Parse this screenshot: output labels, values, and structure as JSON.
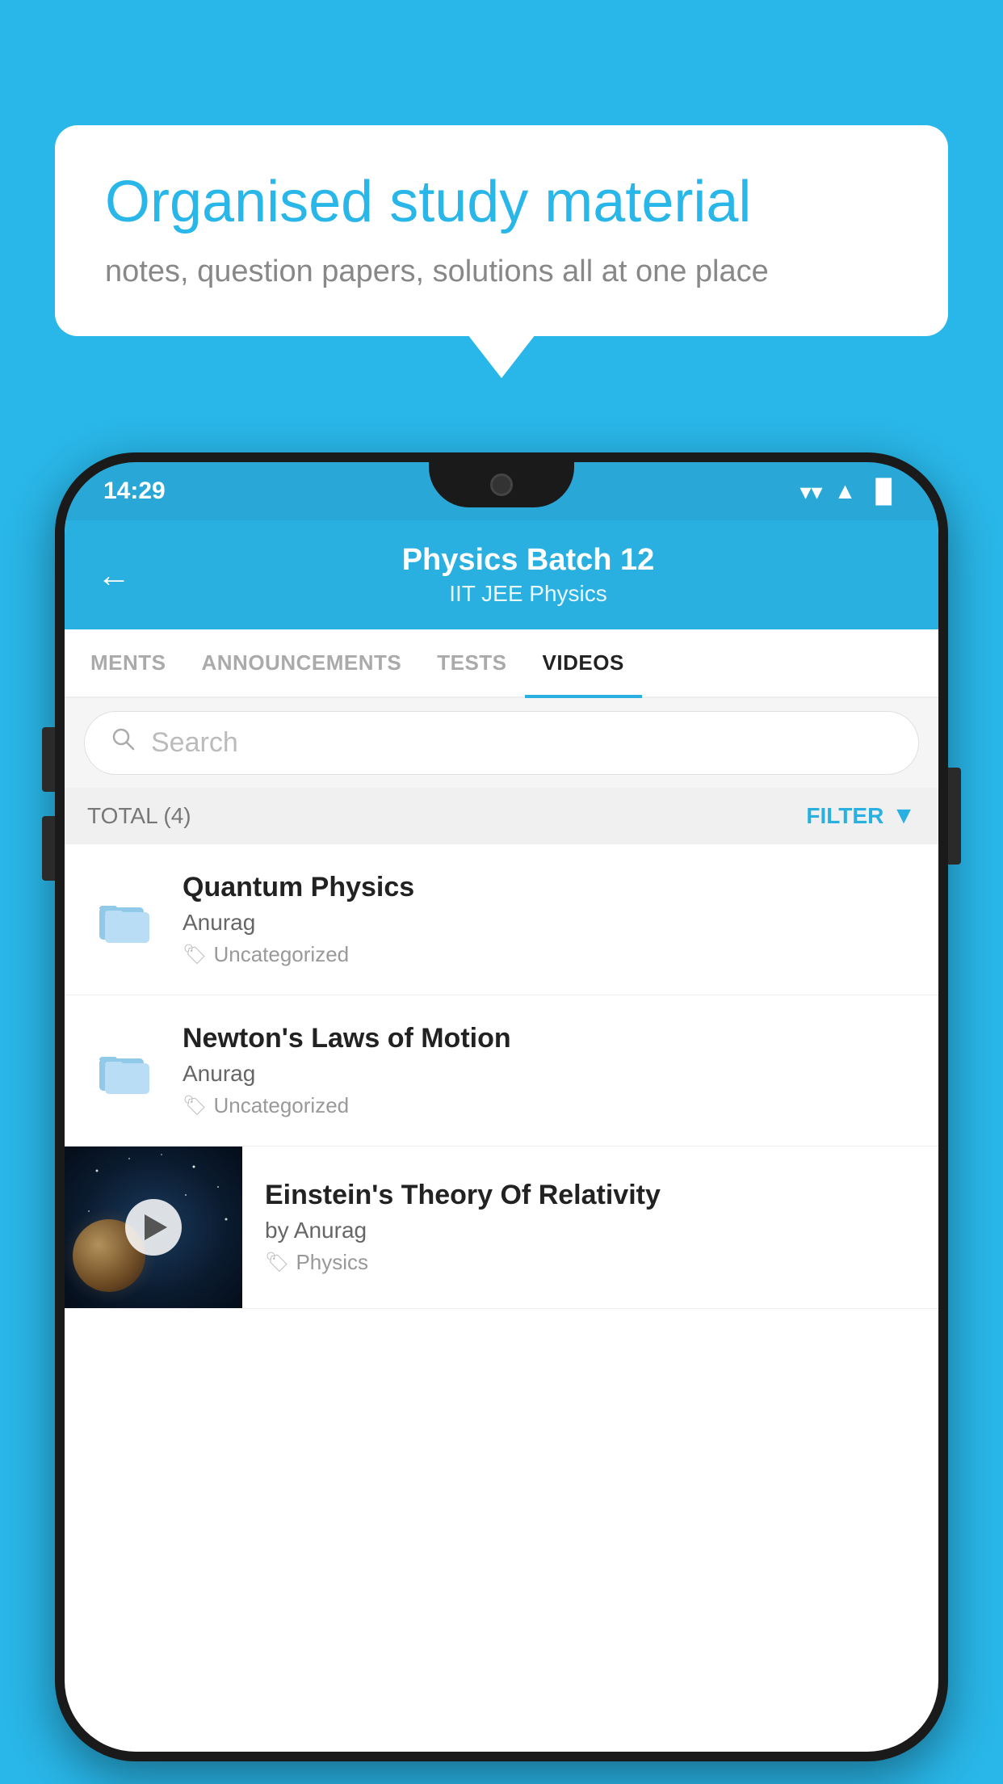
{
  "background_color": "#29b6e8",
  "bubble": {
    "title": "Organised study material",
    "subtitle": "notes, question papers, solutions all at one place"
  },
  "phone": {
    "status_bar": {
      "time": "14:29",
      "wifi": "▾",
      "signal": "▲",
      "battery": "▐"
    },
    "header": {
      "back_label": "←",
      "title": "Physics Batch 12",
      "subtitle": "IIT JEE   Physics"
    },
    "tabs": [
      {
        "label": "MENTS",
        "active": false
      },
      {
        "label": "ANNOUNCEMENTS",
        "active": false
      },
      {
        "label": "TESTS",
        "active": false
      },
      {
        "label": "VIDEOS",
        "active": true
      }
    ],
    "search": {
      "placeholder": "Search"
    },
    "filter_bar": {
      "total_label": "TOTAL (4)",
      "filter_label": "FILTER"
    },
    "videos": [
      {
        "id": 1,
        "title": "Quantum Physics",
        "author": "Anurag",
        "tag": "Uncategorized",
        "type": "folder"
      },
      {
        "id": 2,
        "title": "Newton's Laws of Motion",
        "author": "Anurag",
        "tag": "Uncategorized",
        "type": "folder"
      },
      {
        "id": 3,
        "title": "Einstein's Theory Of Relativity",
        "author": "by Anurag",
        "tag": "Physics",
        "type": "video"
      }
    ]
  }
}
